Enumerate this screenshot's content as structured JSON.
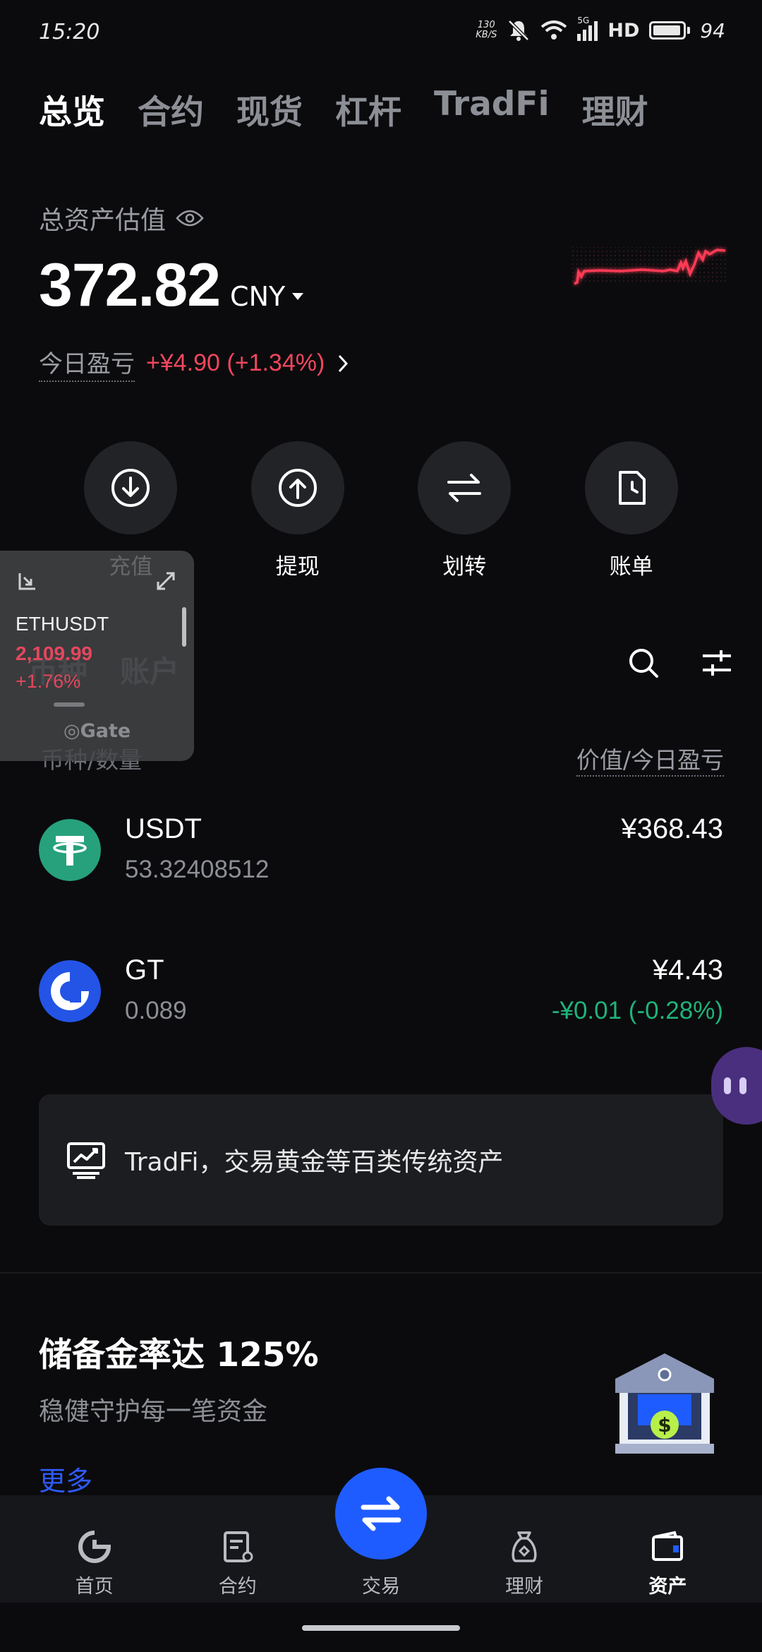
{
  "status_bar": {
    "time": "15:20",
    "net_speed_top": "130",
    "net_speed_bottom": "KB/S",
    "network": "5G",
    "hd": "HD",
    "battery": "94"
  },
  "top_tabs": [
    {
      "label": "总览",
      "active": true
    },
    {
      "label": "合约",
      "active": false
    },
    {
      "label": "现货",
      "active": false
    },
    {
      "label": "杠杆",
      "active": false
    },
    {
      "label": "TradFi",
      "active": false
    },
    {
      "label": "理财",
      "active": false
    }
  ],
  "overview": {
    "total_label": "总资产估值",
    "total_value": "372.82",
    "currency": "CNY",
    "today_pnl_label": "今日盈亏",
    "today_pnl_value": "+¥4.90 (+1.34%)"
  },
  "actions": [
    {
      "label": "充值",
      "icon": "deposit-icon"
    },
    {
      "label": "提现",
      "icon": "withdraw-icon"
    },
    {
      "label": "划转",
      "icon": "transfer-icon"
    },
    {
      "label": "账单",
      "icon": "bill-icon"
    }
  ],
  "section_tabs": [
    "币种",
    "账户"
  ],
  "columns": {
    "left": "币种/数量",
    "right": "价值/今日盈亏"
  },
  "assets": [
    {
      "name": "USDT",
      "quantity": "53.32408512",
      "value": "¥368.43",
      "pnl": ""
    },
    {
      "name": "GT",
      "quantity": "0.089",
      "value": "¥4.43",
      "pnl": "-¥0.01 (-0.28%)"
    }
  ],
  "tradfi_banner": {
    "text": "TradFi，交易黄金等百类传统资产"
  },
  "reserve": {
    "title": "储备金率达 125%",
    "subtitle": "稳健守护每一笔资金",
    "more": "更多"
  },
  "floating_widget": {
    "symbol": "ETHUSDT",
    "price": "2,109.99",
    "change": "+1.76%",
    "brand": "Gate"
  },
  "bottom_nav": [
    {
      "label": "首页",
      "icon": "home-icon",
      "active": false
    },
    {
      "label": "合约",
      "icon": "futures-icon",
      "active": false
    },
    {
      "label": "交易",
      "icon": "trade-icon",
      "active": false
    },
    {
      "label": "理财",
      "icon": "earn-icon",
      "active": false
    },
    {
      "label": "资产",
      "icon": "wallet-icon",
      "active": true
    }
  ],
  "colors": {
    "background": "#0b0b0d",
    "positive": "#f0475d",
    "negative": "#1fb37a",
    "accent": "#1f5cff"
  }
}
